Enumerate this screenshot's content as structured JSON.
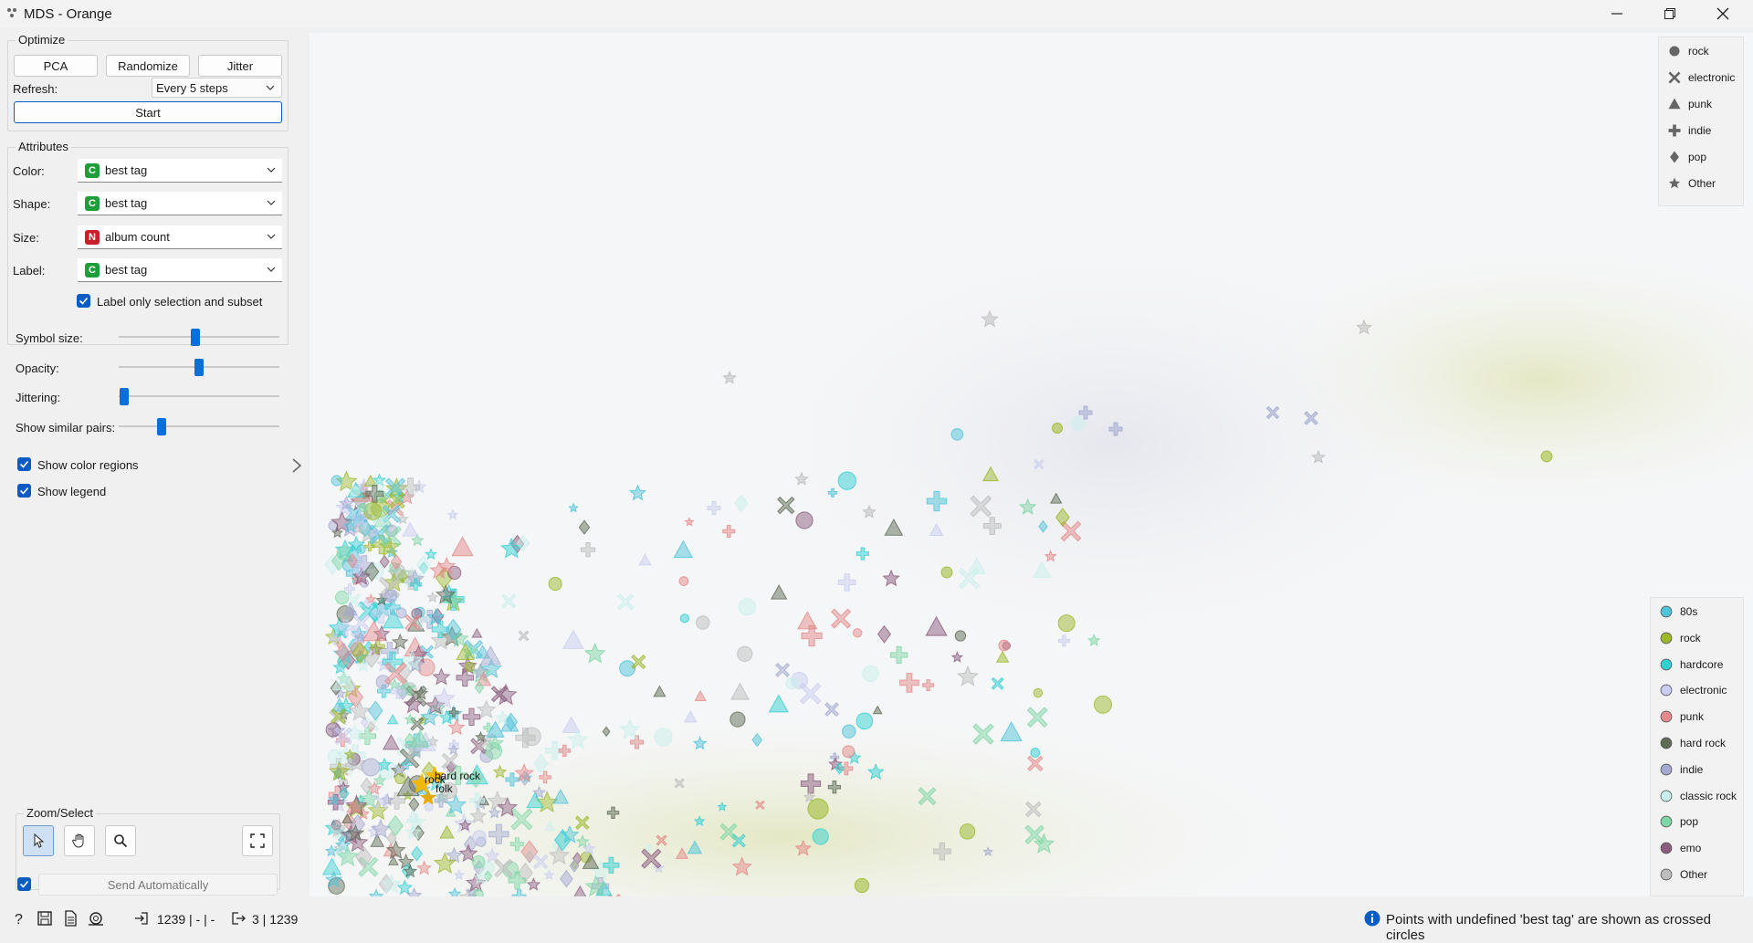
{
  "window": {
    "title": "MDS - Orange"
  },
  "optimize": {
    "title": "Optimize",
    "pca": "PCA",
    "randomize": "Randomize",
    "jitter": "Jitter",
    "refresh_label": "Refresh:",
    "refresh_value": "Every 5 steps",
    "start": "Start"
  },
  "attributes": {
    "title": "Attributes",
    "color_label": "Color:",
    "color_value": "best tag",
    "color_badge": "C",
    "shape_label": "Shape:",
    "shape_value": "best tag",
    "shape_badge": "C",
    "size_label": "Size:",
    "size_value": "album count",
    "size_badge": "N",
    "label_label": "Label:",
    "label_value": "best tag",
    "label_badge": "C",
    "label_only": "Label only selection and subset"
  },
  "sliders": {
    "symbol_size": "Symbol size:",
    "symbol_size_level": 0.47,
    "opacity": "Opacity:",
    "opacity_level": 0.5,
    "jittering": "Jittering:",
    "jittering_level": 0.0,
    "similar_pairs": "Show similar pairs:",
    "similar_pairs_level": 0.25
  },
  "options": {
    "color_regions": "Show color regions",
    "legend": "Show legend"
  },
  "zoom": {
    "title": "Zoom/Select"
  },
  "send": {
    "label": "Send Automatically"
  },
  "status": {
    "input": "1239 | - | -",
    "output": "3 | 1239",
    "info": "Points with undefined 'best tag' are shown as crossed circles"
  },
  "shape_legend": [
    {
      "label": "rock",
      "shape": "circle"
    },
    {
      "label": "electronic",
      "shape": "cross"
    },
    {
      "label": "punk",
      "shape": "triangle"
    },
    {
      "label": "indie",
      "shape": "plus"
    },
    {
      "label": "pop",
      "shape": "diamond"
    },
    {
      "label": "Other",
      "shape": "star"
    }
  ],
  "color_legend": [
    {
      "label": "80s",
      "color": "#4fc3d9"
    },
    {
      "label": "rock",
      "color": "#9cb82b"
    },
    {
      "label": "hardcore",
      "color": "#33d0d3"
    },
    {
      "label": "electronic",
      "color": "#c9cdef"
    },
    {
      "label": "punk",
      "color": "#e48a8a"
    },
    {
      "label": "hard rock",
      "color": "#5f6b55"
    },
    {
      "label": "indie",
      "color": "#a3a9cf"
    },
    {
      "label": "classic rock",
      "color": "#c9f0ec"
    },
    {
      "label": "pop",
      "color": "#7fd6a6"
    },
    {
      "label": "emo",
      "color": "#8b5c7e"
    },
    {
      "label": "Other",
      "color": "#bdbdbd"
    }
  ],
  "plot_labels": {
    "label1": "hard rock",
    "label2": "rock",
    "label3": "folk"
  }
}
